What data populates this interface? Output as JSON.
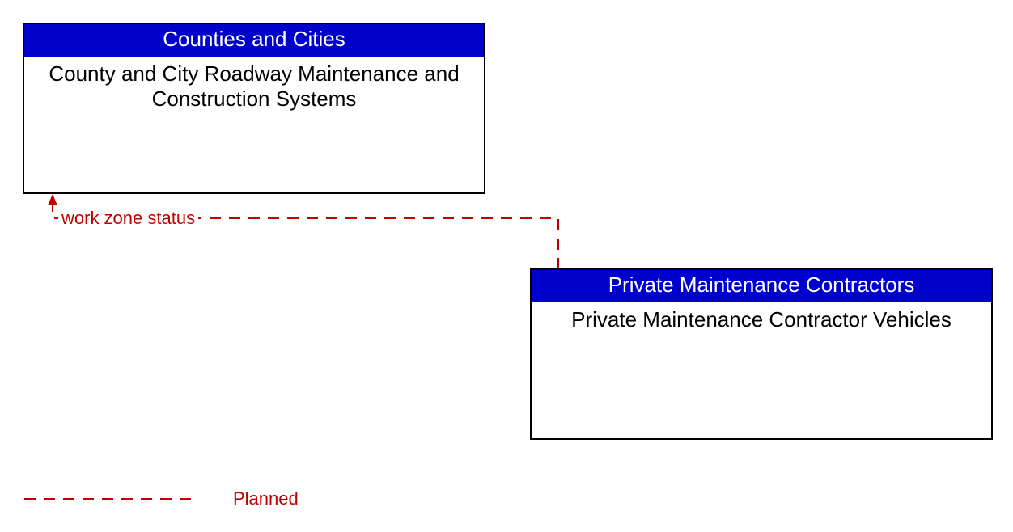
{
  "boxes": {
    "top": {
      "header": "Counties and Cities",
      "body": "County and City Roadway Maintenance and Construction Systems"
    },
    "bottom": {
      "header": "Private Maintenance Contractors",
      "body": "Private Maintenance Contractor Vehicles"
    }
  },
  "flow_label": "work zone status",
  "legend": {
    "planned": "Planned"
  },
  "colors": {
    "header_bg": "#0000cc",
    "header_fg": "#ffffff",
    "flow": "#c00000",
    "border": "#000000"
  }
}
